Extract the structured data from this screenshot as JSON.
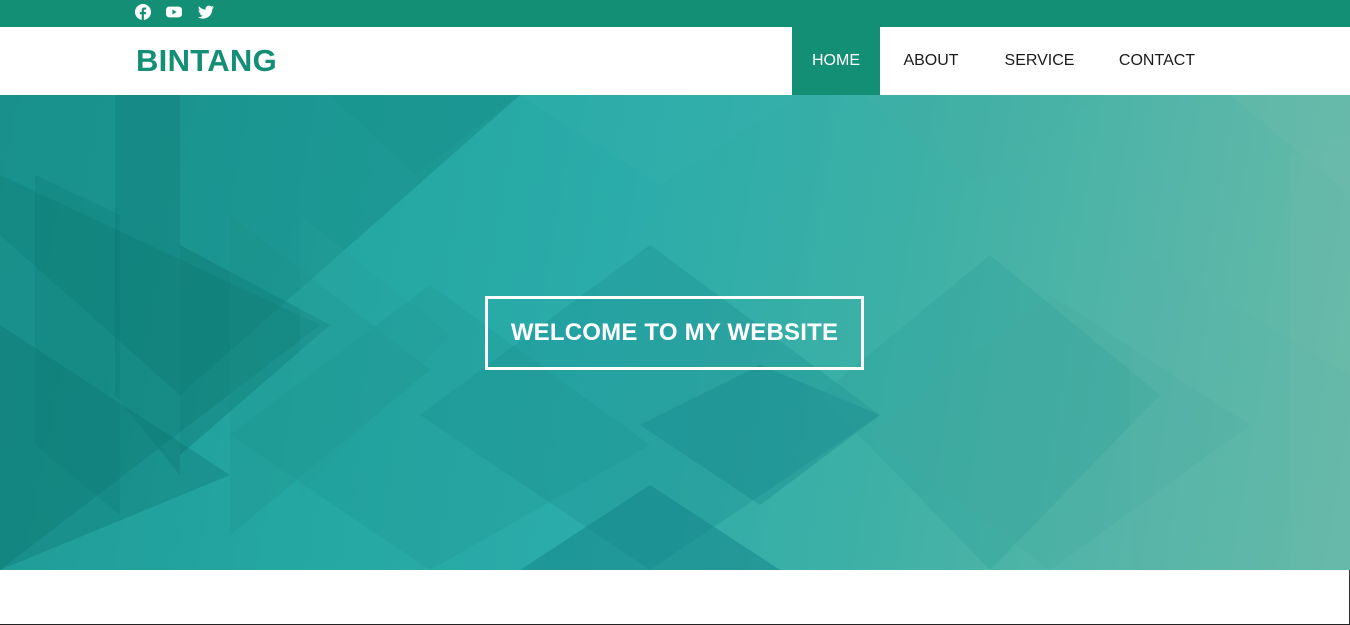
{
  "topbar": {
    "social_icons": [
      "facebook-icon",
      "youtube-icon",
      "twitter-icon"
    ],
    "color": "#138f76"
  },
  "navbar": {
    "brand": "BINTANG",
    "items": [
      {
        "label": "HOME",
        "active": true
      },
      {
        "label": "ABOUT",
        "active": false
      },
      {
        "label": "SERVICE",
        "active": false
      },
      {
        "label": "CONTACT",
        "active": false
      }
    ]
  },
  "hero": {
    "welcome_text": "WELCOME TO MY WEBSITE"
  },
  "colors": {
    "accent": "#138f76",
    "hero_teal": "#2bacaa",
    "hero_light": "#6abba9"
  }
}
